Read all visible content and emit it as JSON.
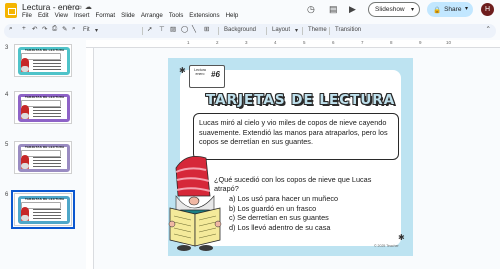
{
  "app": {
    "doc_title": "Lectura - enero",
    "menu": [
      "File",
      "Edit",
      "View",
      "Insert",
      "Format",
      "Slide",
      "Arrange",
      "Tools",
      "Extensions",
      "Help"
    ],
    "slideshow_label": "Slideshow",
    "share_label": "Share",
    "avatar_initial": "H"
  },
  "toolbar": {
    "zoom_label": "Fit",
    "background_label": "Background",
    "layout_label": "Layout",
    "theme_label": "Theme",
    "transition_label": "Transition"
  },
  "filmstrip": {
    "thumbnails": [
      {
        "number": "3",
        "border_color": "#4fc3c9",
        "title": "TARJETAS DE LECTURA"
      },
      {
        "number": "4",
        "border_color": "#8e63c7",
        "title": "TARJETAS DE LECTURA"
      },
      {
        "number": "5",
        "border_color": "#9a8cc2",
        "title": "TARJETAS DE LECTURA"
      },
      {
        "number": "6",
        "border_color": "#4fa7c9",
        "title": "TARJETAS DE LECTURA"
      }
    ]
  },
  "ruler": [
    "1",
    "2",
    "3",
    "4",
    "5",
    "6",
    "7",
    "8",
    "9",
    "10"
  ],
  "slide": {
    "tag_label": "Lectura enero",
    "tag_number": "#6",
    "title": "TARJETAS DE LECTURA",
    "passage": "Lucas miró al cielo y vio miles de copos de nieve cayendo suavemente. Extendió las manos para atraparlos, pero los copos se derretían en sus guantes.",
    "question": "¿Qué sucedió con los copos de nieve que Lucas atrapó?",
    "options": [
      "a) Los usó para hacer un muñeco",
      "b) Los guardó en un frasco",
      "c) Se derretían en sus guantes",
      "d) Los llevó adentro de su casa"
    ],
    "copyright": "© 2025 Teacher"
  },
  "colors": {
    "accent": "#0b57d0",
    "share_bg": "#c2e7ff",
    "slide_frame": "#bde3f1",
    "title_fill": "#bfe1ed"
  }
}
